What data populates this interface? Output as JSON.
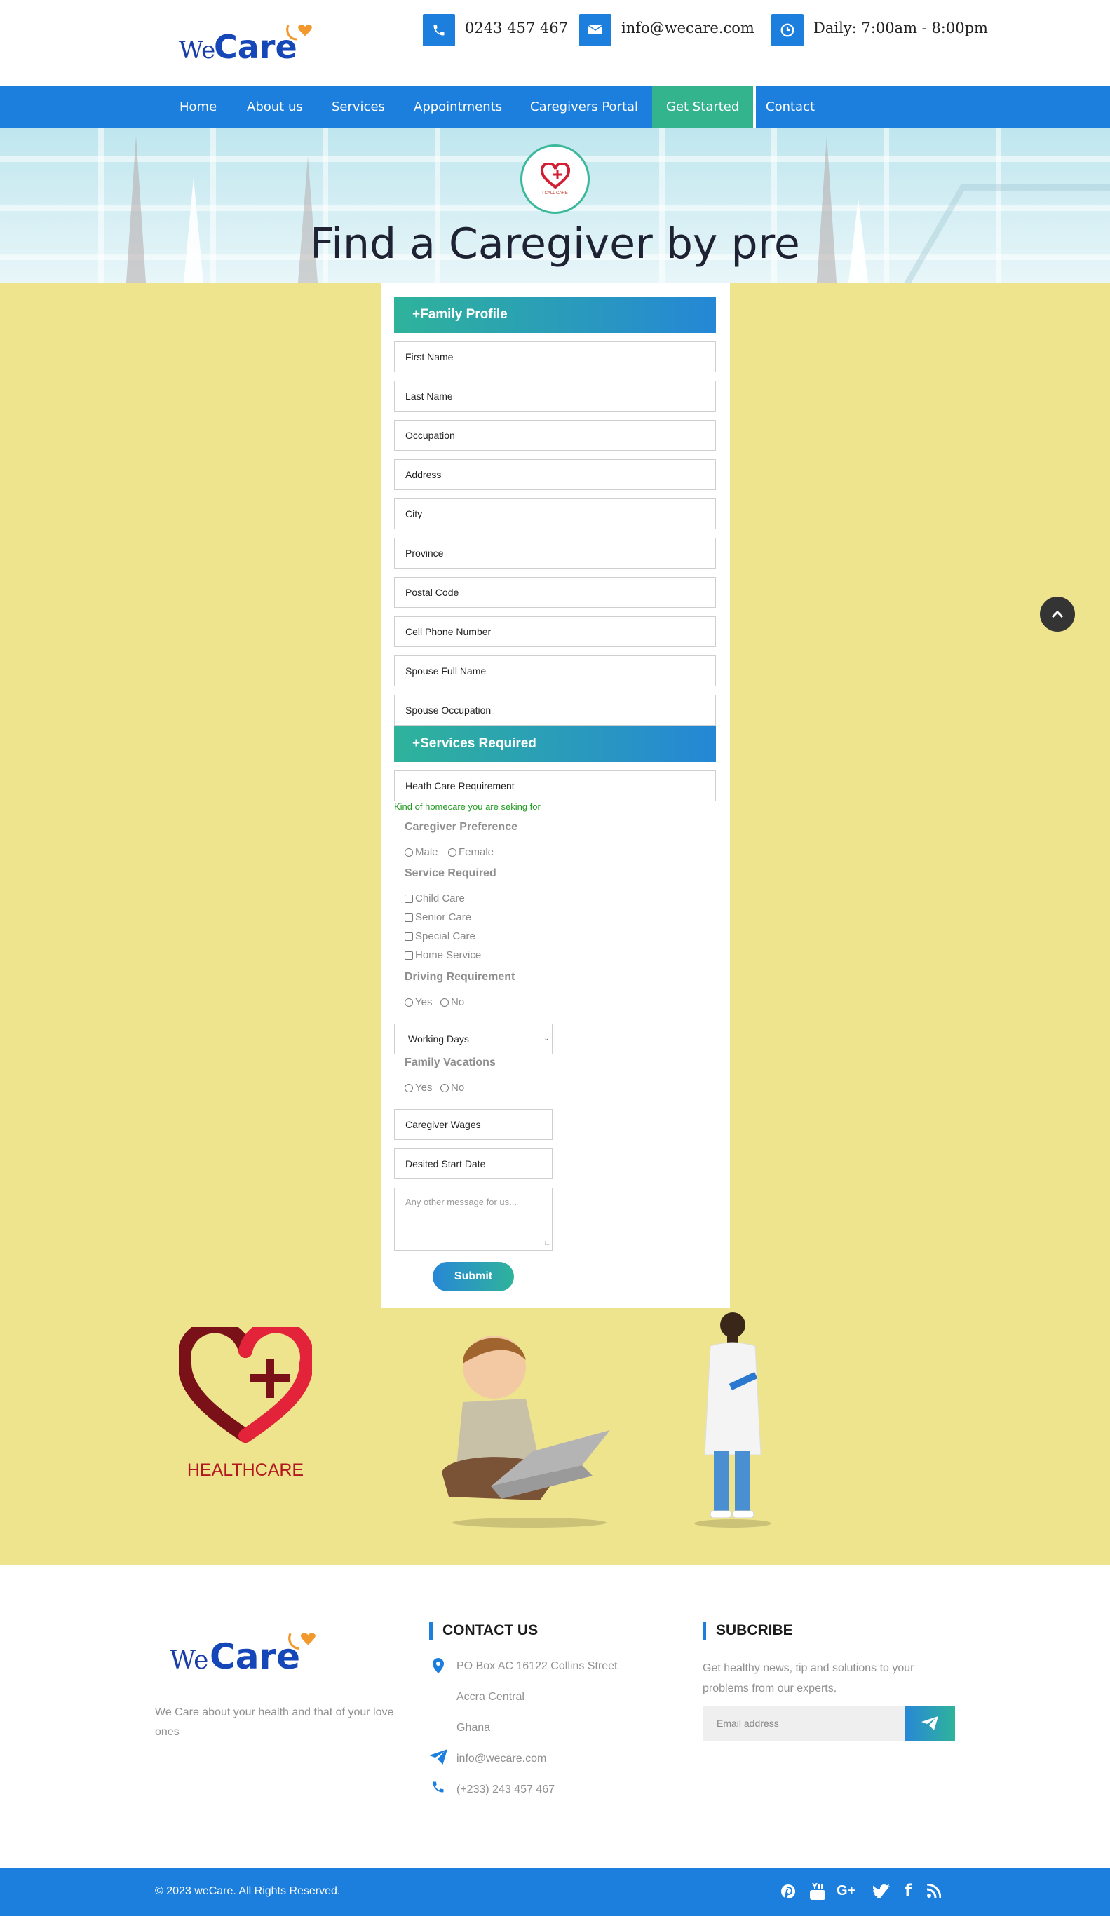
{
  "header": {
    "logo_we": "We",
    "logo_care": "Care",
    "phone": "0243 457 467",
    "email": "info@wecare.com",
    "hours": "Daily: 7:00am - 8:00pm"
  },
  "nav": {
    "items": [
      {
        "label": "Home"
      },
      {
        "label": "About us"
      },
      {
        "label": "Services"
      },
      {
        "label": "Appointments"
      },
      {
        "label": "Caregivers Portal"
      },
      {
        "label": "Get Started",
        "active": true
      },
      {
        "label": "Contact"
      }
    ]
  },
  "hero": {
    "title": "Find a Caregiver by pre",
    "badge_text": "I CALL CARE"
  },
  "form": {
    "family_section": "+Family Profile",
    "family_fields": [
      "First Name",
      "Last Name",
      "Occupation",
      "Address",
      "City",
      "Province",
      "Postal Code",
      "Cell Phone Number",
      "Spouse Full Name",
      "Spouse Occupation"
    ],
    "services_section": "+Services Required",
    "healthcare_field": "Heath Care Requirement",
    "healthcare_hint": "Kind of homecare you are seking for",
    "caregiver_pref_label": "Caregiver Preference",
    "caregiver_pref_options": [
      "Male",
      "Female"
    ],
    "service_required_label": "Service Required",
    "service_options": [
      "Child Care",
      "Senior Care",
      "Special Care",
      "Home Service"
    ],
    "driving_label": "Driving Requirement",
    "driving_options": [
      "Yes",
      "No"
    ],
    "working_days": "Working Days",
    "vacations_label": "Family Vacations",
    "vacations_options": [
      "Yes",
      "No"
    ],
    "wages_field": "Caregiver Wages",
    "start_date_field": "Desited Start Date",
    "message_placeholder": "Any other message for us...",
    "submit_label": "Submit"
  },
  "illustrations": {
    "healthcare_label": "HEALTHCARE"
  },
  "footer": {
    "logo_we": "We",
    "logo_care": "Care",
    "about": "We Care about your health and that of your love ones",
    "contact_heading": "CONTACT US",
    "address_line1": "PO Box AC 16122 Collins Street",
    "address_line2": "Accra Central",
    "address_line3": "Ghana",
    "email": "info@wecare.com",
    "phone": "(+233) 243 457 467",
    "subscribe_heading": "SUBCRIBE",
    "subscribe_text": "Get healthy news, tip and solutions to your problems from our experts.",
    "email_placeholder": "Email address",
    "copyright": "© 2023 weCare. All Rights Reserved."
  },
  "colors": {
    "primary": "#1c7fdd",
    "accent": "#33b48c",
    "main_bg": "#efe48e"
  }
}
